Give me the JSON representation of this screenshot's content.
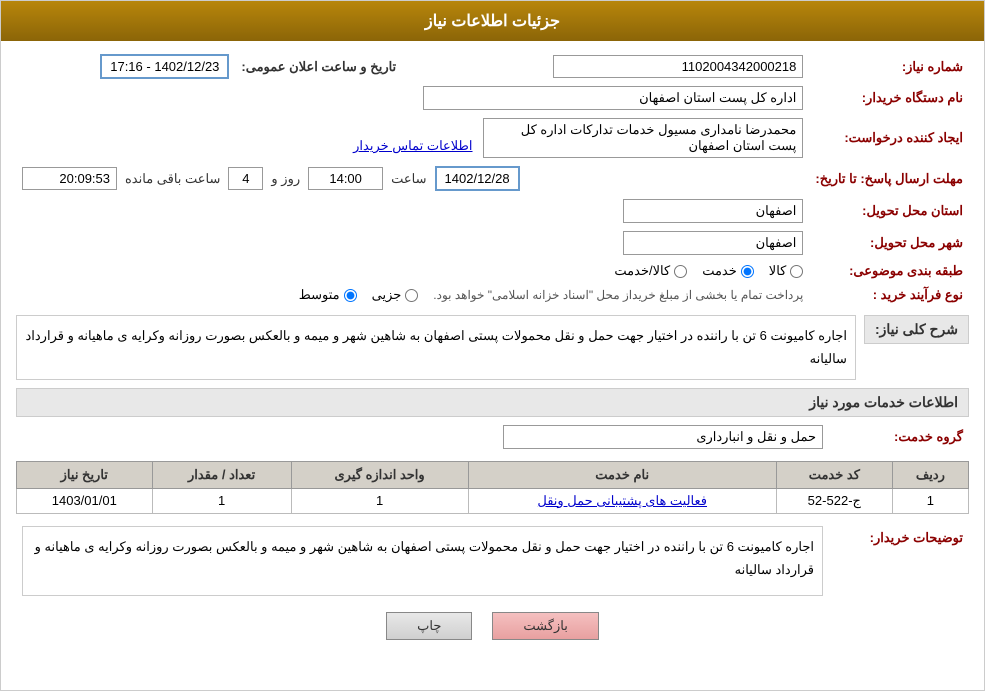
{
  "header": {
    "title": "جزئیات اطلاعات نیاز"
  },
  "fields": {
    "shomara_niaz_label": "شماره نیاز:",
    "shomara_niaz_value": "1102004342000218",
    "nam_dasgah_label": "نام دستگاه خریدار:",
    "nam_dasgah_value": "اداره کل پست استان اصفهان",
    "ijad_label": "ایجاد کننده درخواست:",
    "ijad_value": "محمدرضا نامداری مسیول خدمات تدارکات اداره کل پست استان اصفهان",
    "ijad_link": "اطلاعات تماس خریدار",
    "mohlat_label": "مهلت ارسال پاسخ: تا تاریخ:",
    "mohlat_date": "1402/12/28",
    "mohlat_saat_label": "ساعت",
    "mohlat_saat_value": "14:00",
    "mohlat_rooz_label": "روز و",
    "mohlat_rooz_value": "4",
    "mohlat_baqi_label": "ساعت باقی مانده",
    "mohlat_baqi_value": "20:09:53",
    "tarikh_elan_label": "تاریخ و ساعت اعلان عمومی:",
    "tarikh_elan_value": "1402/12/23 - 17:16",
    "ostan_tahvil_label": "استان محل تحویل:",
    "ostan_tahvil_value": "اصفهان",
    "shahr_tahvil_label": "شهر محل تحویل:",
    "shahr_tahvil_value": "اصفهان",
    "tabaghebandi_label": "طبقه بندی موضوعی:",
    "tabaghebandi_kala": "کالا",
    "tabaghebandi_khedmat": "خدمت",
    "tabaghebandi_kala_khedmat": "کالا/خدمت",
    "tabaghebandi_selected": "khedmat",
    "noeFarayand_label": "نوع فرآیند خرید :",
    "noeFarayand_jozvi": "جزیی",
    "noeFarayand_motavaset": "متوسط",
    "noeFarayand_notice": "پرداخت تمام یا بخشی از مبلغ خریداز محل \"اسناد خزانه اسلامی\" خواهد بود.",
    "noeFarayand_selected": "motavaset"
  },
  "sharh": {
    "section_title": "شرح کلی نیاز:",
    "text": "اجاره کامیونت 6 تن با راننده در اختیار جهت حمل و نقل محمولات پستی اصفهان به شاهین شهر و میمه و بالعکس بصورت روزانه وکرایه ی ماهیانه و قرارداد سالیانه"
  },
  "khadamat": {
    "section_title": "اطلاعات خدمات مورد نیاز",
    "gorohe_label": "گروه خدمت:",
    "gorohe_value": "حمل و نقل و انبارداری",
    "table": {
      "headers": [
        "ردیف",
        "کد خدمت",
        "نام خدمت",
        "واحد اندازه گیری",
        "تعداد / مقدار",
        "تاریخ نیاز"
      ],
      "rows": [
        {
          "radif": "1",
          "code": "ج-522-52",
          "name": "فعالیت های پشتیبانی حمل ونقل",
          "vahed": "1",
          "tedad": "1",
          "tarikh": "1403/01/01"
        }
      ]
    }
  },
  "tozihat": {
    "label": "توضیحات خریدار:",
    "text": "اجاره کامیونت 6 تن با راننده در اختیار جهت حمل و نقل محمولات پستی اصفهان به شاهین شهر و میمه و بالعکس بصورت روزانه وکرایه ی ماهیانه و قرارداد سالیانه"
  },
  "buttons": {
    "print": "چاپ",
    "back": "بازگشت"
  }
}
